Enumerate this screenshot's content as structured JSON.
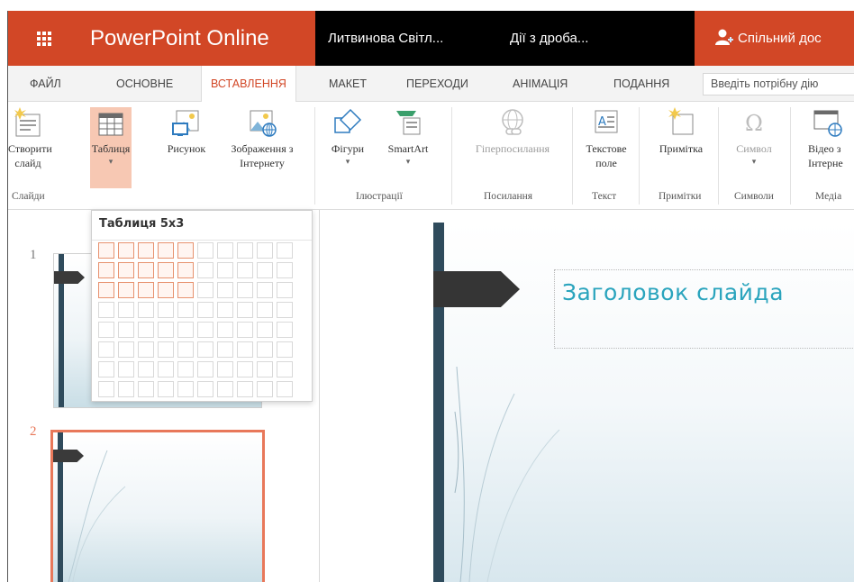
{
  "app": {
    "launcher_icon": "app-launcher-grid-icon",
    "brand": "PowerPoint Online",
    "owner": "Литвинова Світл...",
    "document": "Дії з дроба...",
    "share_label": "Спільний дос",
    "accent_color": "#d24726"
  },
  "tabs": {
    "file": "ФАЙЛ",
    "home": "ОСНОВНЕ",
    "insert": "ВСТАВЛЕННЯ",
    "layout": "МАКЕТ",
    "transitions": "ПЕРЕХОДИ",
    "animations": "АНІМАЦІЯ",
    "view": "ПОДАННЯ",
    "active": "ВСТАВЛЕННЯ",
    "search_text": "Введіть потрібну дію"
  },
  "ribbon": {
    "new_slide": "Створити слайд",
    "table": "Таблиця",
    "picture": "Рисунок",
    "online_pictures": "Зображення з Інтернету",
    "shapes": "Фігури",
    "smartart": "SmartArt",
    "hyperlink": "Гіперпосилання",
    "textbox": "Текстове поле",
    "comment": "Примітка",
    "symbol": "Символ",
    "video": "Відео з Інтерне",
    "groups": {
      "slides": "Слайди",
      "illustrations": "Ілюстрації",
      "links": "Посилання",
      "text": "Текст",
      "comments": "Примітки",
      "symbols": "Символи",
      "media": "Медіа"
    }
  },
  "table_picker": {
    "title": "Таблиця 5x3",
    "selected_columns": 5,
    "selected_rows": 3,
    "grid_columns": 10,
    "grid_rows": 8
  },
  "slides": {
    "items": [
      {
        "number": "1",
        "selected": false
      },
      {
        "number": "2",
        "selected": true
      }
    ],
    "selection_color": "#e8785a"
  },
  "main_slide": {
    "title_placeholder": "Заголовок слайда",
    "title_color": "#2aa4bd"
  }
}
